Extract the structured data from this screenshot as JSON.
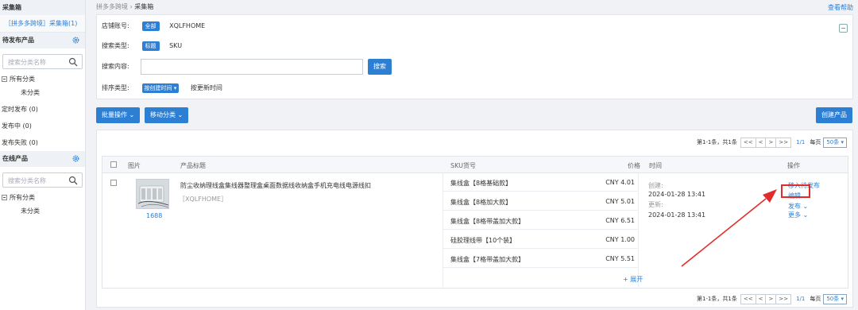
{
  "sidebar": {
    "title": "采集箱",
    "link": "［拼多多跨境］采集箱(1)",
    "pending_title": "待发布产品",
    "search_placeholder": "搜索分类名称",
    "tree_all": "所有分类",
    "tree_uncat": "未分类",
    "items": [
      "定时发布 (0)",
      "发布中 (0)",
      "发布失败 (0)"
    ],
    "online_title": "在线产品",
    "search_placeholder2": "搜索分类名称",
    "tree_all2": "所有分类",
    "tree_uncat2": "未分类"
  },
  "breadcrumb": {
    "parent": "拼多多跨境",
    "sep": "›",
    "current": "采集箱"
  },
  "help": "查看帮助",
  "filter": {
    "shop_label": "店铺账号:",
    "shop_tag": "全部",
    "shop_value": "XQLFHOME",
    "type_label": "搜索类型:",
    "type_tag": "标题",
    "type_value": "SKU",
    "content_label": "搜索内容:",
    "search_btn": "搜索",
    "sort_label": "排序类型:",
    "sort_sel": "按创建时间",
    "sort_alt": "按更新时间"
  },
  "toolbar": {
    "batch": "批量操作",
    "move": "移动分类",
    "create": "创建产品"
  },
  "pager": {
    "summary": "第1-1条，共1条",
    "first": "<<",
    "prev": "<",
    "next": ">",
    "last": ">>",
    "page": "1/1",
    "per_label": "每页",
    "per_value": "50条"
  },
  "table": {
    "headers": [
      "图片",
      "产品标题",
      "SKU货号",
      "价格",
      "时间",
      "操作"
    ],
    "product": {
      "source": "1688",
      "title": "防尘收纳理线盒集线器整理盒桌面数据线收纳盒手机充电线电源线扣",
      "brand": "［XQLFHOME］",
      "skus": [
        {
          "name": "集线盒【8格基础款】",
          "price": "CNY 4.01"
        },
        {
          "name": "集线盒【8格加大款】",
          "price": "CNY 5.01"
        },
        {
          "name": "集线盒【8格带盖加大款】",
          "price": "CNY 6.51"
        },
        {
          "name": "硅胶理线带【10个装】",
          "price": "CNY 1.00"
        },
        {
          "name": "集线盒【7格带盖加大款】",
          "price": "CNY 5.51"
        }
      ],
      "expand": "+ 展开",
      "created_label": "创建:",
      "created": "2024-01-28 13:41",
      "updated_label": "更新:",
      "updated": "2024-01-28 13:41",
      "actions": [
        "移入待发布",
        "编辑",
        "发布",
        "更多"
      ]
    }
  },
  "colors": {
    "accent": "#2d7fd3",
    "highlight": "#e32b2b"
  }
}
